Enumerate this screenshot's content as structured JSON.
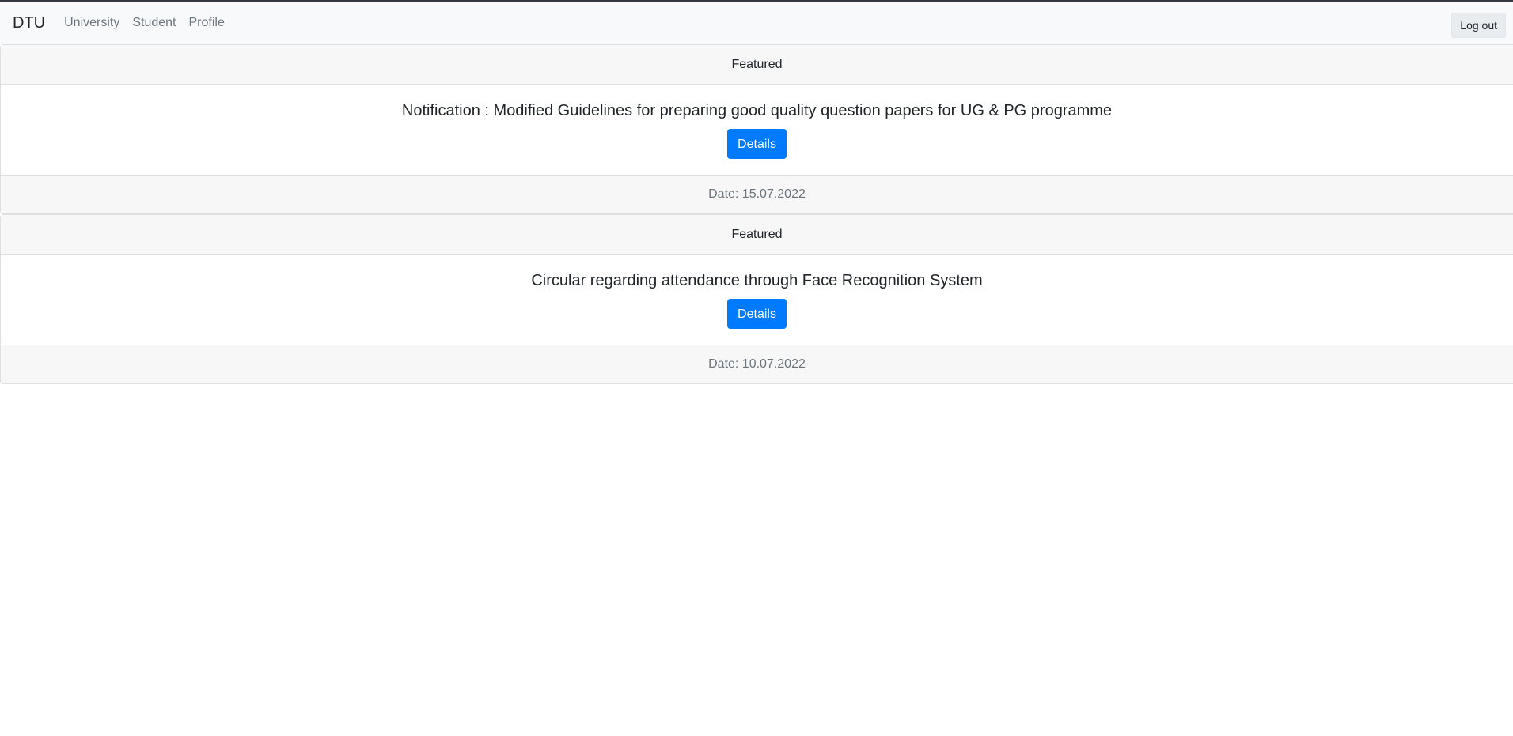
{
  "navbar": {
    "brand": "DTU",
    "links": [
      "University",
      "Student",
      "Profile"
    ],
    "logout_label": "Log out"
  },
  "cards": [
    {
      "header": "Featured",
      "title": "Notification : Modified Guidelines for preparing good quality question papers for UG & PG programme",
      "button_label": "Details",
      "date": "Date: 15.07.2022"
    },
    {
      "header": "Featured",
      "title": "Circular regarding attendance through Face Recognition System",
      "button_label": "Details",
      "date": "Date: 10.07.2022"
    }
  ],
  "colors": {
    "primary": "#007bff",
    "navbar_bg": "#f8f9fa",
    "card_header_bg": "#f7f7f7"
  }
}
